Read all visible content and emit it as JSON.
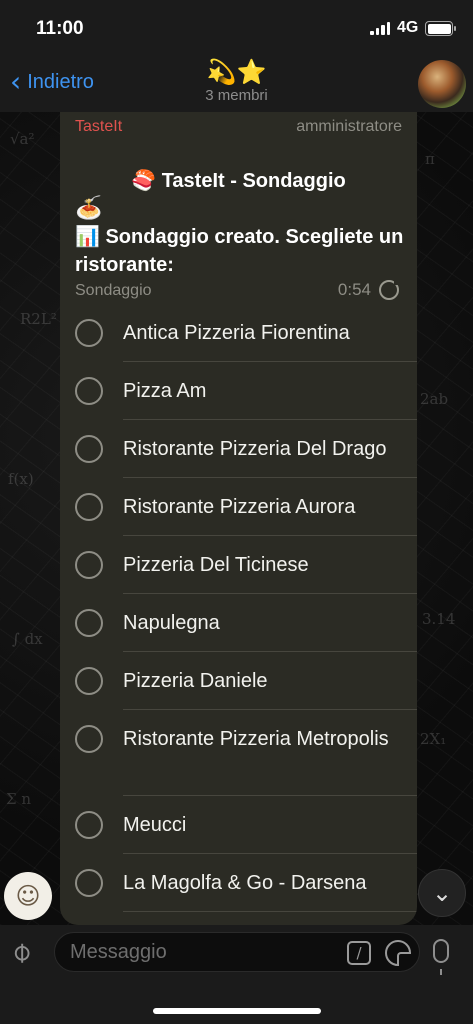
{
  "status_bar": {
    "time": "11:00",
    "network": "4G"
  },
  "header": {
    "back_label": "Indietro",
    "title": "💫⭐",
    "subtitle": "3 membri"
  },
  "message": {
    "sender": "TasteIt",
    "role": "amministratore",
    "poll_title_emoji": "🍣",
    "poll_title": "TasteIt - Sondaggio",
    "food_emoji": "🍝",
    "question_emoji": "📊",
    "question": "Sondaggio creato. Scegliete un ristorante:",
    "poll_type": "Sondaggio",
    "timer": "0:54",
    "options": [
      {
        "label": "Antica Pizzeria Fiorentina"
      },
      {
        "label": "Pizza Am"
      },
      {
        "label": "Ristorante Pizzeria Del Drago"
      },
      {
        "label": "Ristorante Pizzeria Aurora"
      },
      {
        "label": "Pizzeria Del Ticinese"
      },
      {
        "label": "Napulegna"
      },
      {
        "label": "Pizzeria Daniele"
      },
      {
        "label": "Ristorante Pizzeria Metropolis"
      },
      {
        "label": "Meucci"
      },
      {
        "label": "La Magolfa & Go - Darsena"
      }
    ]
  },
  "input": {
    "placeholder": "Messaggio"
  },
  "colors": {
    "accent": "#3e93f0",
    "sender": "#e0524e",
    "bubble": "#2b2b24"
  }
}
